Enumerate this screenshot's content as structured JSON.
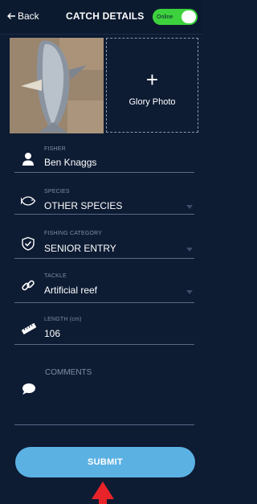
{
  "header": {
    "back_label": "Back",
    "title": "CATCH DETAILS",
    "status_label": "Online"
  },
  "photos": {
    "glory_plus": "+",
    "glory_label": "Glory Photo"
  },
  "fields": {
    "fisher": {
      "label": "FISHER",
      "value": "Ben Knaggs"
    },
    "species": {
      "label": "SPECIES",
      "value": "OTHER SPECIES"
    },
    "category": {
      "label": "FISHING CATEGORY",
      "value": "SENIOR ENTRY"
    },
    "tackle": {
      "label": "TACKLE",
      "value": "Artificial reef"
    },
    "length": {
      "label": "LENGTH (cm)",
      "value": "106"
    }
  },
  "comments": {
    "label": "COMMENTS"
  },
  "submit_label": "SUBMIT",
  "colors": {
    "background": "#0d1b33",
    "online_green": "#3dd23d",
    "submit_blue": "#5cb1e3",
    "annotation_red": "#e8232a"
  }
}
